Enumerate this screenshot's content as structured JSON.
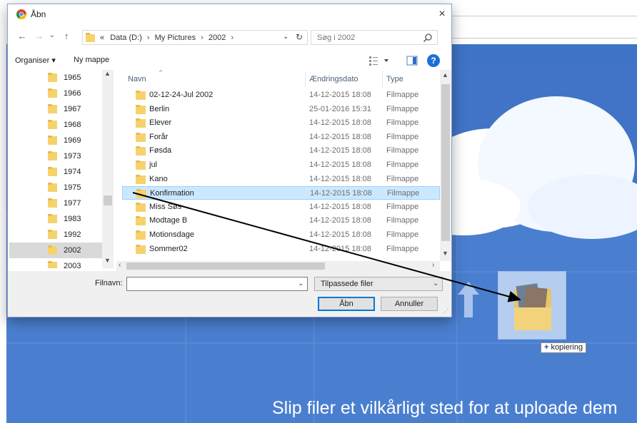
{
  "background": {
    "drop_message": "Slip filer et vilkårligt sted for at uploade dem",
    "accent": "#4a7fd0"
  },
  "drag": {
    "badge_plus": "+",
    "badge_text": "kopiering"
  },
  "dialog": {
    "title": "Åbn",
    "close_glyph": "×",
    "nav": {
      "back": "←",
      "forward": "→",
      "recent": "⌄",
      "up": "↑"
    },
    "path": {
      "overflow": "«",
      "crumbs": [
        "Data (D:)",
        "My Pictures",
        "2002"
      ],
      "sep": "›",
      "dropdown": "⌄",
      "refresh": "↻"
    },
    "search_placeholder": "Søg i 2002",
    "toolbar": {
      "organize": "Organiser ▾",
      "new_folder": "Ny mappe",
      "help": "?"
    },
    "nav_pane": [
      "1965",
      "1966",
      "1967",
      "1968",
      "1969",
      "1973",
      "1974",
      "1975",
      "1977",
      "1983",
      "1992",
      "2002",
      "2003"
    ],
    "nav_selected": "2002",
    "columns": {
      "name": "Navn",
      "date": "Ændringsdato",
      "type": "Type"
    },
    "files": [
      {
        "name": "02-12-24-Jul 2002",
        "date": "14-12-2015 18:08",
        "type": "Filmappe"
      },
      {
        "name": "Berlin",
        "date": "25-01-2016 15:31",
        "type": "Filmappe"
      },
      {
        "name": "Elever",
        "date": "14-12-2015 18:08",
        "type": "Filmappe"
      },
      {
        "name": "Forår",
        "date": "14-12-2015 18:08",
        "type": "Filmappe"
      },
      {
        "name": "Føsda",
        "date": "14-12-2015 18:08",
        "type": "Filmappe"
      },
      {
        "name": "jul",
        "date": "14-12-2015 18:08",
        "type": "Filmappe"
      },
      {
        "name": "Kano",
        "date": "14-12-2015 18:08",
        "type": "Filmappe"
      },
      {
        "name": "Konfirmation",
        "date": "14-12-2015 18:08",
        "type": "Filmappe"
      },
      {
        "name": "Miss Søs",
        "date": "14-12-2015 18:08",
        "type": "Filmappe"
      },
      {
        "name": "Modtage B",
        "date": "14-12-2015 18:08",
        "type": "Filmappe"
      },
      {
        "name": "Motionsdage",
        "date": "14-12-2015 18:08",
        "type": "Filmappe"
      },
      {
        "name": "Sommer02",
        "date": "14-12-2015 18:08",
        "type": "Filmappe"
      }
    ],
    "highlighted_file": "Konfirmation",
    "filename_label": "Filnavn:",
    "filename_value": "",
    "filetype": "Tilpassede filer",
    "open_label": "Åbn",
    "cancel_label": "Annuller"
  }
}
